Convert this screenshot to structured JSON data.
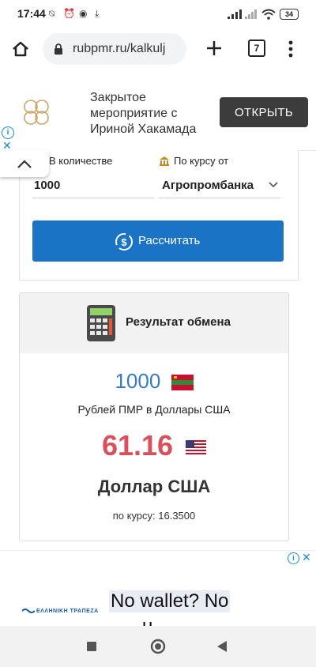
{
  "status_bar": {
    "time": "17:44",
    "battery": "34"
  },
  "browser": {
    "url": "rubpmr.ru/kalkulj",
    "tab_count": "7"
  },
  "top_ad": {
    "text": "Закрытое мероприятие с Ириной Хакамада",
    "button_label": "ОТКРЫТЬ"
  },
  "calculator": {
    "amount_label": "В количестве",
    "amount_value": "1000",
    "bank_label": "По курсу от",
    "bank_value": "Агропромбанка",
    "calculate_label": "Рассчитать"
  },
  "result": {
    "title": "Результат обмена",
    "amount": "1000",
    "conversion_label": "Рублей ПМР в Доллары США",
    "value": "61.16",
    "currency_name": "Доллар США",
    "rate": "по курсу: 16.3500"
  },
  "bottom_ad": {
    "text_line1": "No wallet? No",
    "text_line2_partial": "u",
    "bank_name": "ΕΛΛΗΝΙΚΗ ΤΡΑΠΕΖΑ"
  },
  "colors": {
    "accent": "#1a73c4",
    "result_value": "#d8505c",
    "amount": "#3a7bbf"
  }
}
